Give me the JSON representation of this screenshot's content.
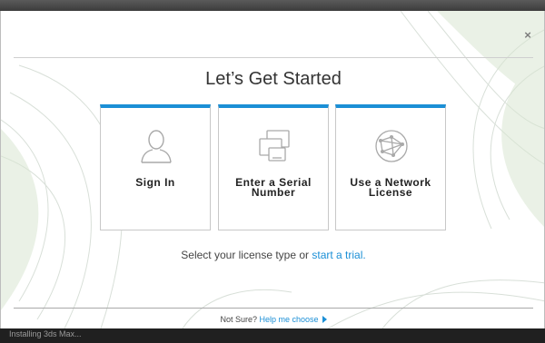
{
  "dialog": {
    "title": "Let’s Get Started",
    "close_icon": "×"
  },
  "options": [
    {
      "label": "Sign In",
      "icon": "person-icon"
    },
    {
      "label": "Enter a Serial Number",
      "icon": "devices-icon"
    },
    {
      "label": "Use a Network License",
      "icon": "network-globe-icon"
    }
  ],
  "prompt": {
    "text": "Select your license type or ",
    "link": "start a trial."
  },
  "footer": {
    "text": "Not Sure?",
    "link": "Help me choose"
  },
  "statusbar": {
    "text": "Installing 3ds Max..."
  },
  "colors": {
    "accent": "#1b8fd6",
    "title_text": "#333333"
  }
}
